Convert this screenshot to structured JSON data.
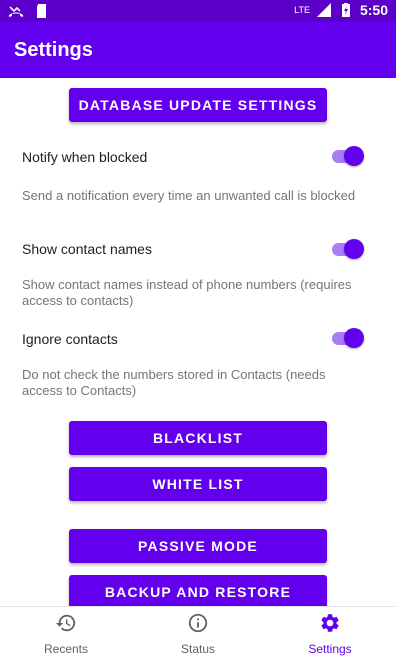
{
  "status_bar": {
    "network": "LTE",
    "time": "5:50"
  },
  "app_bar": {
    "title": "Settings"
  },
  "buttons": {
    "database_update": "DATABASE UPDATE SETTINGS",
    "blacklist": "BLACKLIST",
    "white_list": "WHITE LIST",
    "passive_mode": "PASSIVE MODE",
    "backup_restore": "BACKUP AND RESTORE"
  },
  "settings": [
    {
      "title": "Notify when blocked",
      "description": "Send a notification every time an unwanted call is blocked",
      "enabled": true
    },
    {
      "title": "Show contact names",
      "description": "Show contact names instead of phone numbers (requires access to contacts)",
      "enabled": true
    },
    {
      "title": "Ignore contacts",
      "description": "Do not check the numbers stored in Contacts (needs access to Contacts)",
      "enabled": true
    }
  ],
  "bottom_nav": {
    "items": [
      {
        "label": "Recents",
        "icon": "history-icon",
        "active": false
      },
      {
        "label": "Status",
        "icon": "info-icon",
        "active": false
      },
      {
        "label": "Settings",
        "icon": "gear-icon",
        "active": true
      }
    ]
  },
  "colors": {
    "primary": "#6200ee",
    "status_bar": "#5b00c8",
    "toggle_track": "#a97ef5"
  }
}
